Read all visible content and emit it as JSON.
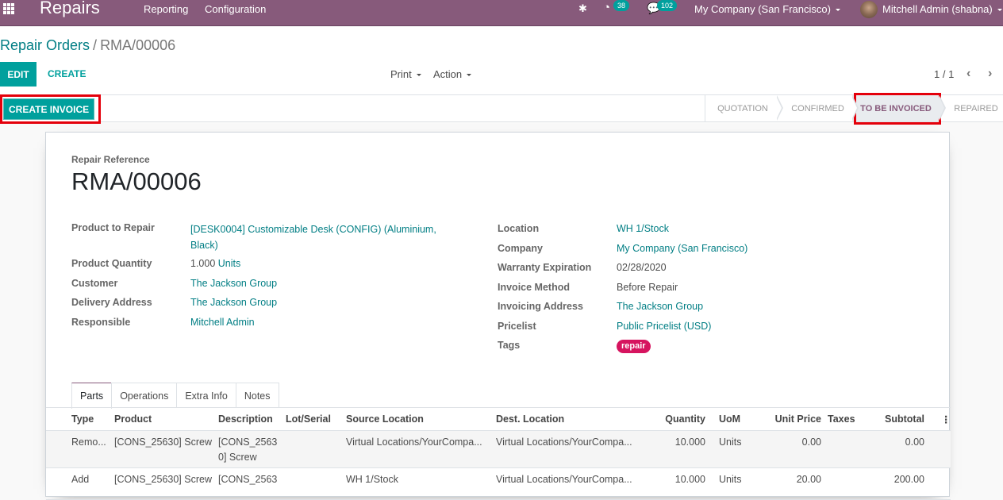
{
  "navbar": {
    "app_name": "Repairs",
    "menus": [
      "Reporting",
      "Configuration"
    ],
    "activity_count": "38",
    "message_count": "102",
    "company": "My Company (San Francisco)",
    "user": "Mitchell Admin (shabna)",
    "bg_color": "#875a7b"
  },
  "breadcrumb": {
    "parent": "Repair Orders",
    "separator": "/",
    "current": "RMA/00006"
  },
  "toolbar": {
    "edit_label": "EDIT",
    "create_label": "CREATE",
    "print_label": "Print",
    "action_label": "Action",
    "pager": "1 / 1",
    "prev_icon": "‹",
    "next_icon": "›"
  },
  "statusbar": {
    "create_invoice_label": "CREATE INVOICE",
    "stages": [
      "QUOTATION",
      "CONFIRMED",
      "TO BE INVOICED",
      "REPAIRED"
    ],
    "active_stage": "TO BE INVOICED"
  },
  "form": {
    "reference_label": "Repair Reference",
    "reference": "RMA/00006",
    "left_fields": {
      "product_label": "Product to Repair",
      "product_value_line1": "[DESK0004] Customizable Desk (CONFIG) (Aluminium,",
      "product_value_line2": "Black)",
      "quantity_label": "Product Quantity",
      "quantity_value": "1.000",
      "quantity_uom": "Units",
      "customer_label": "Customer",
      "customer_value": "The Jackson Group",
      "delivery_label": "Delivery Address",
      "delivery_value": "The Jackson Group",
      "responsible_label": "Responsible",
      "responsible_value": "Mitchell Admin"
    },
    "right_fields": {
      "location_label": "Location",
      "location_value": "WH 1/Stock",
      "company_label": "Company",
      "company_value": "My Company (San Francisco)",
      "warranty_label": "Warranty Expiration",
      "warranty_value": "02/28/2020",
      "invoice_method_label": "Invoice Method",
      "invoice_method_value": "Before Repair",
      "invoicing_address_label": "Invoicing Address",
      "invoicing_address_value": "The Jackson Group",
      "pricelist_label": "Pricelist",
      "pricelist_value": "Public Pricelist (USD)",
      "tags_label": "Tags",
      "tag_value": "repair",
      "tag_color": "#d6145f"
    }
  },
  "tabs": [
    "Parts",
    "Operations",
    "Extra Info",
    "Notes"
  ],
  "active_tab": "Parts",
  "parts_table": {
    "columns": [
      "Type",
      "Product",
      "Description",
      "Lot/Serial",
      "Source Location",
      "Dest. Location",
      "Quantity",
      "UoM",
      "Unit Price",
      "Taxes",
      "Subtotal"
    ],
    "rows": [
      {
        "type": "Remo...",
        "product": "[CONS_25630] Screw",
        "description": "[CONS_25630] Screw",
        "lot": "",
        "source": "Virtual Locations/YourCompa...",
        "dest": "Virtual Locations/YourCompa...",
        "quantity": "10.000",
        "uom": "Units",
        "unit_price": "0.00",
        "taxes": "",
        "subtotal": "0.00"
      },
      {
        "type": "Add",
        "product": "[CONS_25630] Screw",
        "description": "[CONS_2563",
        "lot": "",
        "source": "WH 1/Stock",
        "dest": "Virtual Locations/YourCompa...",
        "quantity": "10.000",
        "uom": "Units",
        "unit_price": "20.00",
        "taxes": "",
        "subtotal": "200.00"
      }
    ]
  }
}
